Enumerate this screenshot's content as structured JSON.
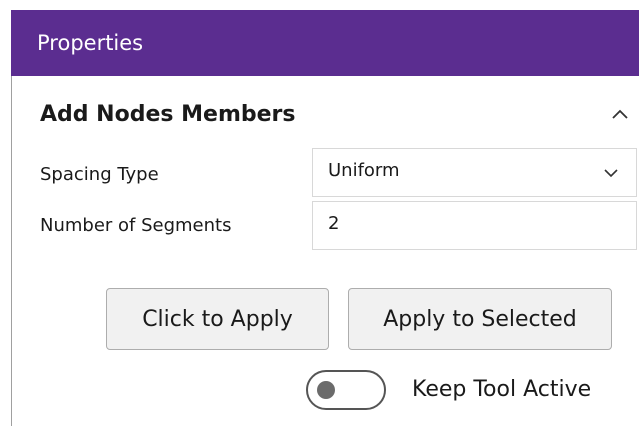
{
  "header": {
    "title": "Properties",
    "accent_color": "#5b2d90"
  },
  "section": {
    "title": "Add Nodes Members",
    "collapse_icon": "chevron-up-icon"
  },
  "fields": {
    "spacing_type": {
      "label": "Spacing Type",
      "value": "Uniform",
      "icon": "chevron-down-icon"
    },
    "number_of_segments": {
      "label": "Number of Segments",
      "value": "2"
    }
  },
  "buttons": {
    "click_to_apply": "Click to Apply",
    "apply_to_selected": "Apply to Selected"
  },
  "toggle": {
    "label": "Keep Tool Active",
    "state": "off"
  }
}
